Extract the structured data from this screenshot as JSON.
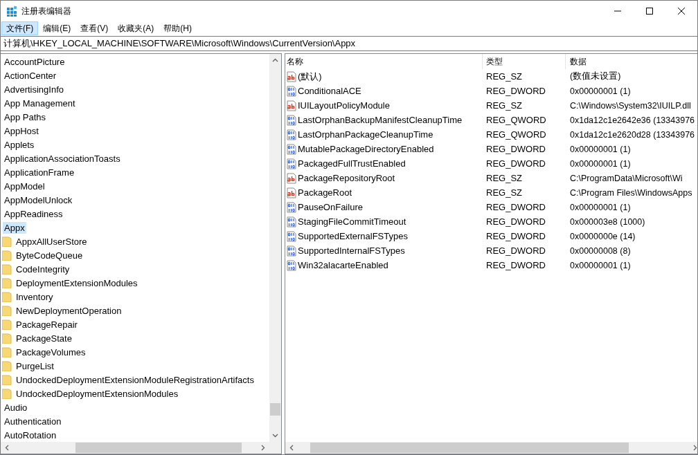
{
  "window": {
    "title": "注册表编辑器"
  },
  "menu": [
    {
      "label": "文件(F)",
      "selected": true
    },
    {
      "label": "编辑(E)",
      "selected": false
    },
    {
      "label": "查看(V)",
      "selected": false
    },
    {
      "label": "收藏夹(A)",
      "selected": false
    },
    {
      "label": "帮助(H)",
      "selected": false
    }
  ],
  "address_bar": {
    "value": "计算机\\HKEY_LOCAL_MACHINE\\SOFTWARE\\Microsoft\\Windows\\CurrentVersion\\Appx"
  },
  "tree": [
    {
      "label": "AccountPicture",
      "selected": false
    },
    {
      "label": "ActionCenter",
      "selected": false
    },
    {
      "label": "AdvertisingInfo",
      "selected": false
    },
    {
      "label": "App Management",
      "selected": false
    },
    {
      "label": "App Paths",
      "selected": false
    },
    {
      "label": "AppHost",
      "selected": false
    },
    {
      "label": "Applets",
      "selected": false
    },
    {
      "label": "ApplicationAssociationToasts",
      "selected": false
    },
    {
      "label": "ApplicationFrame",
      "selected": false
    },
    {
      "label": "AppModel",
      "selected": false
    },
    {
      "label": "AppModelUnlock",
      "selected": false
    },
    {
      "label": "AppReadiness",
      "selected": false
    },
    {
      "label": "Appx",
      "selected": true,
      "children": [
        {
          "label": "AppxAllUserStore",
          "selected": false
        },
        {
          "label": "ByteCodeQueue",
          "selected": false
        },
        {
          "label": "CodeIntegrity",
          "selected": false
        },
        {
          "label": "DeploymentExtensionModules",
          "selected": false
        },
        {
          "label": "Inventory",
          "selected": false
        },
        {
          "label": "NewDeploymentOperation",
          "selected": false
        },
        {
          "label": "PackageRepair",
          "selected": false
        },
        {
          "label": "PackageState",
          "selected": false
        },
        {
          "label": "PackageVolumes",
          "selected": false
        },
        {
          "label": "PurgeList",
          "selected": false
        },
        {
          "label": "UndockedDeploymentExtensionModuleRegistrationArtifacts",
          "selected": false
        },
        {
          "label": "UndockedDeploymentExtensionModules",
          "selected": false
        }
      ]
    },
    {
      "label": "Audio",
      "selected": false
    },
    {
      "label": "Authentication",
      "selected": false
    },
    {
      "label": "AutoRotation",
      "selected": false
    }
  ],
  "table": {
    "columns": [
      "名称",
      "类型",
      "数据"
    ],
    "rows": [
      {
        "kind": "string",
        "name": "(默认)",
        "type": "REG_SZ",
        "data": "(数值未设置)"
      },
      {
        "kind": "binary",
        "name": "ConditionalACE",
        "type": "REG_DWORD",
        "data": "0x00000001 (1)"
      },
      {
        "kind": "string",
        "name": "IUILayoutPolicyModule",
        "type": "REG_SZ",
        "data": "C:\\Windows\\System32\\IUILP.dll"
      },
      {
        "kind": "binary",
        "name": "LastOrphanBackupManifestCleanupTime",
        "type": "REG_QWORD",
        "data": "0x1da12c1e2642e36 (13343976"
      },
      {
        "kind": "binary",
        "name": "LastOrphanPackageCleanupTime",
        "type": "REG_QWORD",
        "data": "0x1da12c1e2620d28 (13343976"
      },
      {
        "kind": "binary",
        "name": "MutablePackageDirectoryEnabled",
        "type": "REG_DWORD",
        "data": "0x00000001 (1)"
      },
      {
        "kind": "binary",
        "name": "PackagedFullTrustEnabled",
        "type": "REG_DWORD",
        "data": "0x00000001 (1)"
      },
      {
        "kind": "string",
        "name": "PackageRepositoryRoot",
        "type": "REG_SZ",
        "data": "C:\\ProgramData\\Microsoft\\Wi"
      },
      {
        "kind": "string",
        "name": "PackageRoot",
        "type": "REG_SZ",
        "data": "C:\\Program Files\\WindowsApps"
      },
      {
        "kind": "binary",
        "name": "PauseOnFailure",
        "type": "REG_DWORD",
        "data": "0x00000001 (1)"
      },
      {
        "kind": "binary",
        "name": "StagingFileCommitTimeout",
        "type": "REG_DWORD",
        "data": "0x000003e8 (1000)"
      },
      {
        "kind": "binary",
        "name": "SupportedExternalFSTypes",
        "type": "REG_DWORD",
        "data": "0x0000000e (14)"
      },
      {
        "kind": "binary",
        "name": "SupportedInternalFSTypes",
        "type": "REG_DWORD",
        "data": "0x00000008 (8)"
      },
      {
        "kind": "binary",
        "name": "Win32alacarteEnabled",
        "type": "REG_DWORD",
        "data": "0x00000001 (1)"
      }
    ]
  }
}
